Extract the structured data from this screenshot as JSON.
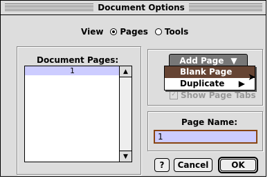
{
  "window": {
    "title": "Document Options"
  },
  "view": {
    "label": "View",
    "options": [
      "Pages",
      "Tools"
    ],
    "selected": "Pages"
  },
  "pages": {
    "label": "Document Pages:",
    "items": [
      "1"
    ]
  },
  "add_page": {
    "label": "Add Page",
    "menu": [
      {
        "label": "Blank Page",
        "selected": true
      },
      {
        "label": "Duplicate",
        "submenu": true
      }
    ]
  },
  "show_tabs": {
    "label": "Show Page Tabs",
    "checked": true,
    "enabled": false
  },
  "page_name": {
    "label": "Page Name:",
    "value": "1"
  },
  "buttons": {
    "help": "?",
    "cancel": "Cancel",
    "ok": "OK"
  }
}
